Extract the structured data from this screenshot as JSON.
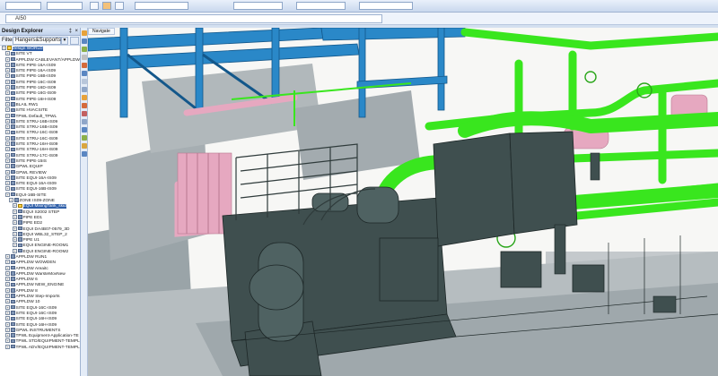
{
  "toolbar": {
    "address_value": "AI50"
  },
  "explorer": {
    "title": "Design Explorer",
    "pin_glyph": "‡",
    "close_glyph": "×",
    "filter_label": "Filter",
    "filter_value": "Hangers&Supports",
    "items": [
      {
        "label": "Design WORLD",
        "indent": 0,
        "sel": true
      },
      {
        "label": "SITE VT",
        "indent": 1
      },
      {
        "label": "APPLDW CABLEVANT/APPLDW",
        "indent": 1
      },
      {
        "label": "SITE PIPE-16A-IS09",
        "indent": 1
      },
      {
        "label": "SITE PIPE-16A-IS09",
        "indent": 1
      },
      {
        "label": "SITE PIPE-16B-IS09",
        "indent": 1
      },
      {
        "label": "SITE PIPE-16C-IS09",
        "indent": 1
      },
      {
        "label": "SITE PIPE-16D-IS09",
        "indent": 1
      },
      {
        "label": "SITE PIPE-16G-IS09",
        "indent": 1
      },
      {
        "label": "SITE PIPE-16H-IS09",
        "indent": 1
      },
      {
        "label": "BLAIL RW1",
        "indent": 1
      },
      {
        "label": "SITE HVACSITE",
        "indent": 1
      },
      {
        "label": "TPWL Default_TPWL",
        "indent": 1
      },
      {
        "label": "SITE STRU-16B-IS09",
        "indent": 1
      },
      {
        "label": "SITE STRU-16B-IS09",
        "indent": 1
      },
      {
        "label": "SITE STRU-16C-IS09",
        "indent": 1
      },
      {
        "label": "SITE STRU-16C-IS09",
        "indent": 1
      },
      {
        "label": "SITE STRU-16H-IS09",
        "indent": 1
      },
      {
        "label": "SITE STRU-16H-IS09",
        "indent": 1
      },
      {
        "label": "SITE STRU-17C-IS09",
        "indent": 1
      },
      {
        "label": "SITE PIPE-15IS",
        "indent": 1
      },
      {
        "label": "GPWL EQUIP",
        "indent": 1
      },
      {
        "label": "GPWL REVIEW",
        "indent": 1
      },
      {
        "label": "SITE EQUI-16A-IS09",
        "indent": 1
      },
      {
        "label": "SITE EQUI-16A-IS09",
        "indent": 1
      },
      {
        "label": "SITE EQUI-16B-IS09",
        "indent": 1
      },
      {
        "label": "EQUI-16B-SITE",
        "indent": 1
      },
      {
        "label": "ZONE IS09-ZONE",
        "indent": 2
      },
      {
        "label": "EQUI MixingTank_skid",
        "indent": 3,
        "sel": true
      },
      {
        "label": "EQUI S2002 STEP",
        "indent": 3
      },
      {
        "label": "PIPE ED1",
        "indent": 3
      },
      {
        "label": "PIPE ED2",
        "indent": 3
      },
      {
        "label": "EQUI DA4B07-0579_3D",
        "indent": 3
      },
      {
        "label": "EQUI WBL32_STEP_2",
        "indent": 3
      },
      {
        "label": "PIPE U1",
        "indent": 3
      },
      {
        "label": "EQUI ENGINE-ROOM1",
        "indent": 3
      },
      {
        "label": "EQUI ENGINE-ROOM2",
        "indent": 3
      },
      {
        "label": "APPLDW RUN1",
        "indent": 1
      },
      {
        "label": "APPLDW WOWDEN",
        "indent": 1
      },
      {
        "label": "APPLDW Areaitc",
        "indent": 1
      },
      {
        "label": "APPLDW WarsteMovNew",
        "indent": 1
      },
      {
        "label": "APPLDW 6",
        "indent": 1
      },
      {
        "label": "APPLDW NEW_ENGINE",
        "indent": 1
      },
      {
        "label": "APPLDW 8",
        "indent": 1
      },
      {
        "label": "APPLDW Step-Imports",
        "indent": 1
      },
      {
        "label": "APPLDW 10",
        "indent": 1
      },
      {
        "label": "SITE EQUI-16C-IS09",
        "indent": 1
      },
      {
        "label": "SITE EQUI-16C-IS09",
        "indent": 1
      },
      {
        "label": "SITE EQUI-16H-IS09",
        "indent": 1
      },
      {
        "label": "SITE EQUI-16H-IS09",
        "indent": 1
      },
      {
        "label": "GPWL INSTRUMENTS",
        "indent": 1
      },
      {
        "label": "TPWL Equipment-Application-TE",
        "indent": 1
      },
      {
        "label": "TPWL STD/EQUIPMENT-TEMPL",
        "indent": 1
      },
      {
        "label": "TPWL ADV/EQUIPMENT-TEMPL",
        "indent": 1
      }
    ]
  },
  "viewport": {
    "tab_label": "Navigate"
  },
  "colors": {
    "accent": "#2f5fa8",
    "pipe_green": "#39e61e",
    "steel_blue": "#2a88c8",
    "equipment": "#3f4f4f",
    "pink_pipe": "#e6a8c0"
  }
}
